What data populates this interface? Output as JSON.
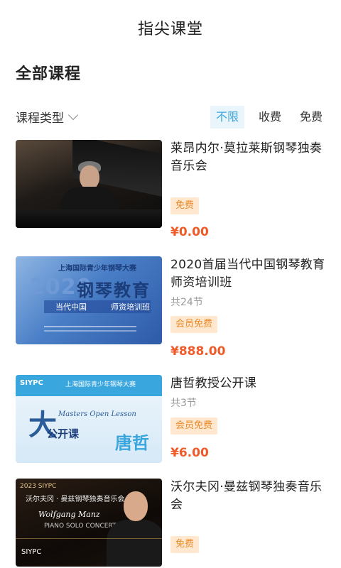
{
  "header": {
    "title": "指尖课堂"
  },
  "section_title": "全部课程",
  "filter": {
    "type_label": "课程类型",
    "segments": [
      {
        "label": "不限",
        "active": true
      },
      {
        "label": "收费",
        "active": false
      },
      {
        "label": "免费",
        "active": false
      }
    ]
  },
  "courses": [
    {
      "title": "莱昂内尔·莫拉莱斯钢琴独奏音乐会",
      "lessons": "",
      "tag": "免费",
      "price": "¥0.00"
    },
    {
      "title": "2020首届当代中国钢琴教育师资培训班",
      "lessons": "共24节",
      "tag": "会员免费",
      "price": "¥888.00",
      "thumb": {
        "header": "上海国际青少年钢琴大赛",
        "year": "2020",
        "big": "钢琴教育",
        "left": "当代中国",
        "right": "师资培训班"
      }
    },
    {
      "title": "唐哲教授公开课",
      "lessons": "共3节",
      "tag": "会员免费",
      "price": "¥6.00",
      "thumb": {
        "logo": "SIYPC",
        "header": "上海国际青少年钢琴大赛",
        "brush": "大",
        "script": "Masters Open Lesson",
        "open": "公开课",
        "name": "唐哲"
      }
    },
    {
      "title": "沃尔夫冈·曼兹钢琴独奏音乐会",
      "lessons": "",
      "tag": "免费",
      "price": "",
      "thumb": {
        "top": "2023 SIYPC",
        "sub": "沃尔夫冈 · 曼兹钢琴独奏音乐会",
        "name": "Wolfgang Manz",
        "piano": "PIANO SOLO CONCERT",
        "logo": "SIYPC"
      }
    }
  ],
  "colors": {
    "accent": "#3aa6de",
    "price": "#f05a28",
    "tag_bg": "#ffe8cf",
    "tag_text": "#e98b2a"
  }
}
